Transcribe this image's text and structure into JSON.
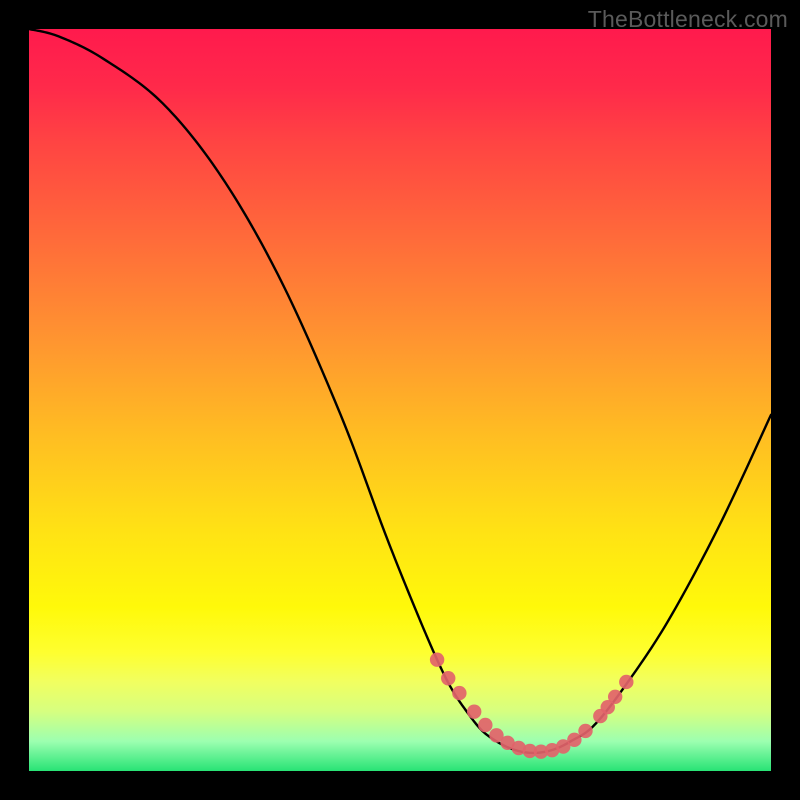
{
  "watermark": "TheBottleneck.com",
  "colors": {
    "background": "#000000",
    "curve": "#000000",
    "marker": "#e2636a",
    "marker_stroke": "#e2636a"
  },
  "chart_data": {
    "type": "line",
    "title": "",
    "xlabel": "",
    "ylabel": "",
    "xlim": [
      0,
      100
    ],
    "ylim": [
      0,
      100
    ],
    "grid": false,
    "legend": false,
    "series": [
      {
        "name": "bottleneck-curve",
        "x": [
          0,
          4,
          10,
          18,
          26,
          34,
          42,
          48,
          52,
          55,
          57,
          59,
          61,
          63,
          65,
          67,
          69,
          71,
          73,
          76,
          80,
          86,
          93,
          100
        ],
        "y": [
          100,
          99,
          96,
          90,
          80,
          66,
          48,
          32,
          22,
          15,
          11,
          8,
          5.5,
          4,
          3,
          2.5,
          2.5,
          3,
          4,
          6,
          11,
          20,
          33,
          48
        ]
      }
    ],
    "markers": {
      "name": "highlighted-points",
      "x": [
        55,
        56.5,
        58,
        60,
        61.5,
        63,
        64.5,
        66,
        67.5,
        69,
        70.5,
        72,
        73.5,
        75,
        77,
        78,
        79,
        80.5
      ],
      "y": [
        15,
        12.5,
        10.5,
        8,
        6.2,
        4.8,
        3.8,
        3.1,
        2.7,
        2.6,
        2.8,
        3.3,
        4.2,
        5.4,
        7.4,
        8.6,
        10.0,
        12.0
      ]
    }
  }
}
